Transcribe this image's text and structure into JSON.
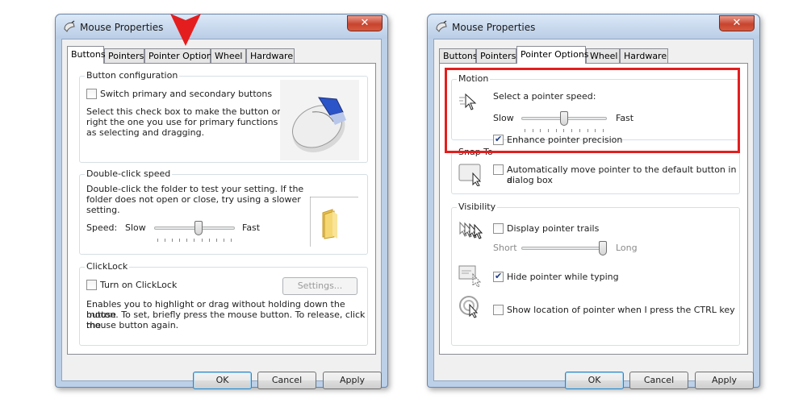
{
  "windows": [
    {
      "title": "Mouse Properties",
      "close": "✕",
      "tabs": [
        "Buttons",
        "Pointers",
        "Pointer Options",
        "Wheel",
        "Hardware"
      ],
      "active_tab": "Buttons",
      "button_config": {
        "title": "Button configuration",
        "switch_label": "Switch primary and secondary buttons",
        "switch_checked": false,
        "desc_lines": [
          "Select this check box to make the button on the",
          "right the one you use for primary functions such",
          "as selecting and dragging."
        ]
      },
      "double_click": {
        "title": "Double-click speed",
        "desc_lines": [
          "Double-click the folder to test your setting. If the",
          "folder does not open or close, try using a slower",
          "setting."
        ],
        "speed_label": "Speed:",
        "slow": "Slow",
        "fast": "Fast",
        "slider_value": 0.55
      },
      "clicklock": {
        "title": "ClickLock",
        "label": "Turn on ClickLock",
        "checked": false,
        "settings_button": "Settings...",
        "desc_lines": [
          "Enables you to highlight or drag without holding down the mouse",
          "button. To set, briefly press the mouse button. To release, click the",
          "mouse button again."
        ]
      },
      "buttons": {
        "ok": "OK",
        "cancel": "Cancel",
        "apply": "Apply"
      }
    },
    {
      "title": "Mouse Properties",
      "close": "✕",
      "tabs": [
        "Buttons",
        "Pointers",
        "Pointer Options",
        "Wheel",
        "Hardware"
      ],
      "active_tab": "Pointer Options",
      "motion": {
        "title": "Motion",
        "speed_label": "Select a pointer speed:",
        "slow": "Slow",
        "fast": "Fast",
        "slider_value": 0.5,
        "precision_label": "Enhance pointer precision",
        "precision_checked": true
      },
      "snap_to": {
        "title": "Snap To",
        "label_lines": [
          "Automatically move pointer to the default button in a",
          "dialog box"
        ],
        "checked": false
      },
      "visibility": {
        "title": "Visibility",
        "trails_label": "Display pointer trails",
        "trails_checked": false,
        "short": "Short",
        "long": "Long",
        "trails_slider_value": 1.0,
        "hide_label": "Hide pointer while typing",
        "hide_checked": true,
        "show_location_label": "Show location of pointer when I press the CTRL key",
        "show_location_checked": false
      },
      "buttons": {
        "ok": "OK",
        "cancel": "Cancel",
        "apply": "Apply"
      }
    }
  ],
  "annotations": {
    "arrow_color": "#e41e1e",
    "highlight_color": "#e41e1e"
  }
}
